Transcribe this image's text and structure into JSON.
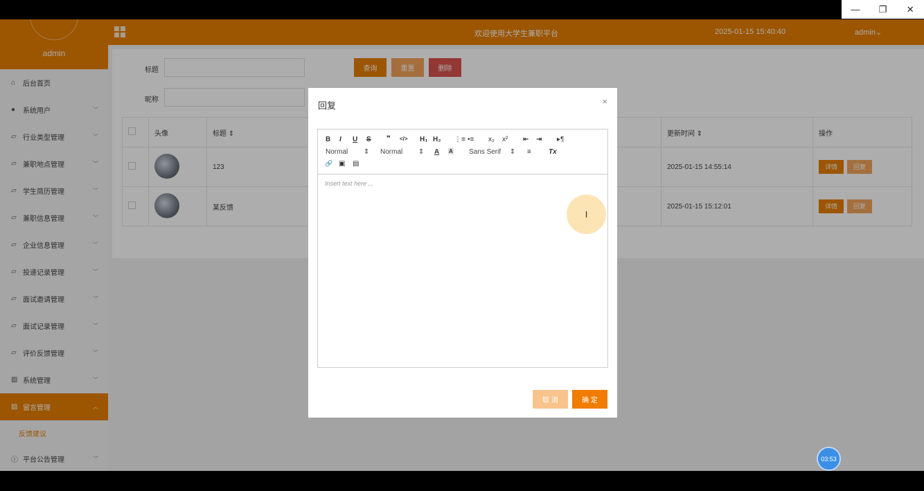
{
  "window": {
    "minimize_icon": "—",
    "restore_icon": "❐",
    "close_icon": "✕"
  },
  "sidebar": {
    "user": "admin",
    "items": [
      {
        "label": "后台首页",
        "icon": "home-icon"
      },
      {
        "label": "系统用户",
        "icon": "user-icon"
      },
      {
        "label": "行业类型管理",
        "icon": "doc-icon"
      },
      {
        "label": "兼职地点管理",
        "icon": "doc-icon"
      },
      {
        "label": "学生简历管理",
        "icon": "doc-icon"
      },
      {
        "label": "兼职信息管理",
        "icon": "doc-icon"
      },
      {
        "label": "企业信息管理",
        "icon": "doc-icon"
      },
      {
        "label": "投递记录管理",
        "icon": "doc-icon"
      },
      {
        "label": "面试邀请管理",
        "icon": "doc-icon"
      },
      {
        "label": "面试记录管理",
        "icon": "doc-icon"
      },
      {
        "label": "评价反馈管理",
        "icon": "doc-icon"
      },
      {
        "label": "系统管理",
        "icon": "image-icon"
      },
      {
        "label": "留言管理",
        "icon": "image-icon"
      },
      {
        "label": "平台公告管理",
        "icon": "info-icon"
      }
    ],
    "sub_item": "反馈建议"
  },
  "topbar": {
    "welcome": "欢迎使用大学生兼职平台",
    "datetime": "2025-01-15 15:40:40",
    "admin": "admin"
  },
  "search": {
    "title_label": "标题",
    "nickname_label": "昵称",
    "query": "查询",
    "reset": "重置",
    "delete": "删除"
  },
  "table": {
    "headers": {
      "avatar": "头像",
      "title": "标题",
      "updated": "更新时间",
      "action": "操作"
    },
    "rows": [
      {
        "title": "123",
        "updated": "2025-01-15 14:55:14"
      },
      {
        "title": "某反馈",
        "updated": "2025-01-15 15:12:01"
      }
    ],
    "detail": "详情",
    "reply": "回复"
  },
  "dialog": {
    "title": "回复",
    "close": "×",
    "placeholder": "Insert text here ...",
    "cancel": "取 消",
    "confirm": "确 定",
    "toolbar": {
      "bold": "B",
      "italic": "I",
      "underline": "U",
      "strike": "S",
      "quote": "❞",
      "code": "</>",
      "h1": "H₁",
      "h2": "H₂",
      "ol": "⋮≡",
      "ul": "•≡",
      "sub": "x₂",
      "sup": "x²",
      "outdent": "⇤",
      "indent": "⇥",
      "rtl": "▸¶",
      "size_select": "Normal",
      "header_select": "Normal",
      "font_select": "Sans Serif",
      "color": "A",
      "background": "A",
      "align": "≡",
      "clean": "Tx",
      "link": "🔗",
      "image": "▣",
      "video": "▤"
    }
  },
  "timer": "03:53",
  "colors": {
    "accent": "#e67e00",
    "danger": "#d9534f"
  }
}
